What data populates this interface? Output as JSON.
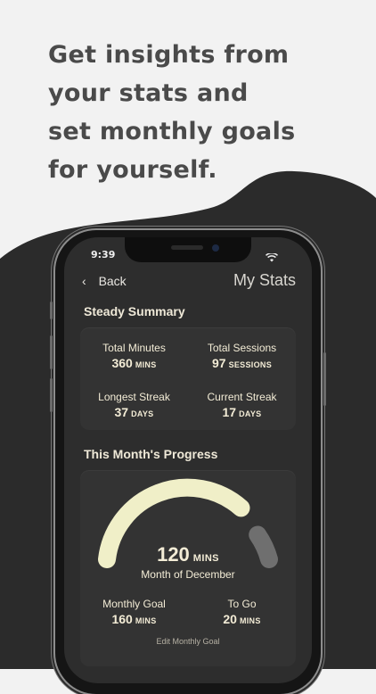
{
  "headline": [
    "Get insights from",
    "your stats and",
    "set monthly goals",
    "for yourself."
  ],
  "status_bar": {
    "time": "9:39"
  },
  "nav": {
    "back_label": "Back",
    "title": "My Stats"
  },
  "summary": {
    "title": "Steady Summary",
    "stats": [
      {
        "label": "Total Minutes",
        "value": "360",
        "unit": "MINS"
      },
      {
        "label": "Total Sessions",
        "value": "97",
        "unit": "SESSIONS"
      },
      {
        "label": "Longest Streak",
        "value": "37",
        "unit": "DAYS"
      },
      {
        "label": "Current Streak",
        "value": "17",
        "unit": "DAYS"
      }
    ]
  },
  "progress": {
    "title": "This Month's Progress",
    "minutes": "120",
    "unit": "MINS",
    "period": "Month of December",
    "goal_label": "Monthly Goal",
    "goal_value": "160",
    "goal_unit": "MINS",
    "togo_label": "To Go",
    "togo_value": "20",
    "togo_unit": "MINS",
    "edit_label": "Edit Monthly Goal"
  },
  "colors": {
    "accent": "#f0efc8",
    "track": "#6f6f6f",
    "background": "#2d2d2d",
    "text": "#f3ecd6"
  }
}
